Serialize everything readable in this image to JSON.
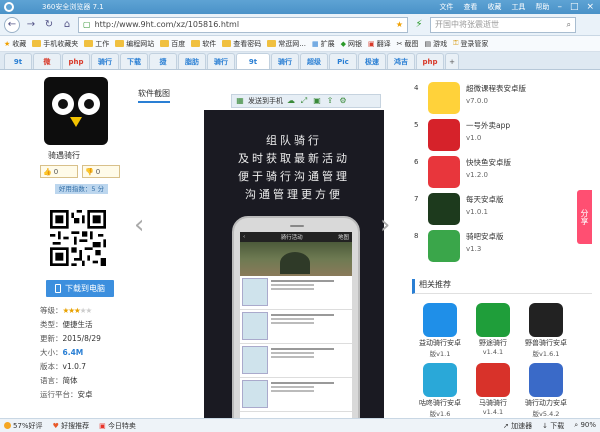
{
  "window": {
    "title": "360安全浏览器 7.1",
    "menu": [
      "文件",
      "查看",
      "收藏",
      "工具",
      "帮助"
    ]
  },
  "address": {
    "url": "http://www.9ht.com/xz/105816.html",
    "search_placeholder": "开国中将张震逝世"
  },
  "favbar": {
    "items": [
      "收藏",
      "手机收藏夹",
      "工作",
      "编程网站",
      "百度",
      "软件",
      "查看密码",
      "常逛网...",
      "扩展",
      "网银",
      "翻译",
      "截图",
      "游戏",
      "登录管家"
    ]
  },
  "tabs": [
    "9t",
    "微",
    "php",
    "骑行",
    "下载",
    "捷",
    "脂肪",
    "骑行",
    "9t",
    "骑行",
    "超级",
    "Pic",
    "极速",
    "鸿吉",
    "php"
  ],
  "app": {
    "name": "骑遇骑行",
    "vote_up": "0",
    "vote_down": "0",
    "rating_text": "好用指数：5 分",
    "download_label": "下载到电脑",
    "info": [
      {
        "label": "等级：",
        "value": ""
      },
      {
        "label": "类型：",
        "value": "便捷生活"
      },
      {
        "label": "更新：",
        "value": "2015/8/29"
      },
      {
        "label": "大小：",
        "value": "6.4M"
      },
      {
        "label": "版本：",
        "value": "v1.0.7"
      },
      {
        "label": "语言：",
        "value": "简体"
      },
      {
        "label": "运行平台：",
        "value": "安卓"
      }
    ],
    "stars": 3
  },
  "screenshots": {
    "tab_label": "软件截图",
    "send_to_phone": "发送到手机",
    "overlay_lines": [
      "组队骑行",
      "及时获取最新活动",
      "便于骑行沟通管理",
      "沟通管理更方便"
    ],
    "phone_header_left": "‹",
    "phone_header_center": "骑行活动",
    "phone_header_right": "地图"
  },
  "rank_list": [
    {
      "num": "4",
      "title": "超微课程表安卓版",
      "ver": "v7.0.0",
      "color": "#ffd23a"
    },
    {
      "num": "5",
      "title": "一号外卖app",
      "ver": "v1.0",
      "color": "#d6222a"
    },
    {
      "num": "6",
      "title": "快快鱼安卓版",
      "ver": "v1.2.0",
      "color": "#e8363c"
    },
    {
      "num": "7",
      "title": "每天安卓版",
      "ver": "v1.0.1",
      "color": "#1d3a1d"
    },
    {
      "num": "8",
      "title": "骑吧安卓版",
      "ver": "v1.3",
      "color": "#3aa64a"
    }
  ],
  "related": {
    "heading": "相关推荐",
    "items": [
      {
        "name": "益动骑行安卓",
        "ver": "版v1.1",
        "color": "#1f8fe8"
      },
      {
        "name": "野途骑行",
        "ver": "v1.4.1",
        "color": "#1f9e3a"
      },
      {
        "name": "野兽骑行安卓",
        "ver": "版v1.6.1",
        "color": "#222222"
      },
      {
        "name": "咕咚骑行安卓",
        "ver": "版v1.6",
        "color": "#2aa8d8"
      },
      {
        "name": "马骑骑行",
        "ver": "v1.4.1",
        "color": "#d8322a"
      },
      {
        "name": "骑行动力安卓",
        "ver": "版v5.4.2",
        "color": "#3a6ac8"
      }
    ]
  },
  "share_label": "分享",
  "status": {
    "left": [
      "57%好评",
      "好搜推荐",
      "今日特卖"
    ],
    "right": [
      "加速器",
      "下载",
      "90%"
    ]
  }
}
